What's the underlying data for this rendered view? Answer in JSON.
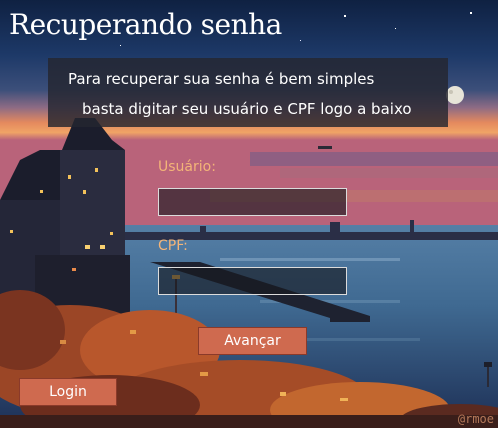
{
  "page": {
    "title": "Recuperando senha"
  },
  "info": {
    "line1": "Para recuperar sua senha é bem simples",
    "line2": "basta digitar seu usuário e CPF logo a baixo"
  },
  "form": {
    "username_label": "Usuário:",
    "username_value": "",
    "cpf_label": "CPF:",
    "cpf_value": ""
  },
  "buttons": {
    "next_label": "Avançar",
    "login_label": "Login"
  },
  "background": {
    "artist_signature": "@rmoe"
  },
  "colors": {
    "button": "#cf6a4f",
    "label": "#f3b478",
    "panel": "#242630"
  }
}
